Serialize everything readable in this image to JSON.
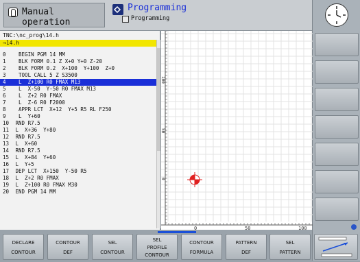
{
  "header": {
    "manual_label": "Manual operation",
    "programming_label": "Programming",
    "programming_sub": "Programming"
  },
  "program": {
    "path": "TNC:\\nc_prog\\14.h",
    "file": "→14.h",
    "selected_line": 4,
    "lines": [
      {
        "n": "0",
        "code": "  BEGIN PGM 14 MM"
      },
      {
        "n": "1",
        "code": "  BLK FORM 0.1 Z X+0 Y+0 Z-20"
      },
      {
        "n": "2",
        "code": "  BLK FORM 0.2  X+100  Y+100  Z+0"
      },
      {
        "n": "3",
        "code": "  TOOL CALL 5 Z S3500"
      },
      {
        "n": "4",
        "code": "  L  Z+100 R0 FMAX M13"
      },
      {
        "n": "5",
        "code": "  L  X-50  Y-50 R0 FMAX M13"
      },
      {
        "n": "6",
        "code": "  L  Z+2 R0 FMAX"
      },
      {
        "n": "7",
        "code": "  L  Z-6 R0 F2000"
      },
      {
        "n": "8",
        "code": "  APPR LCT  X+12  Y+5 R5 RL F250"
      },
      {
        "n": "9",
        "code": "  L  Y+60"
      },
      {
        "n": "10",
        "code": " RND R7.5"
      },
      {
        "n": "11",
        "code": " L  X+36  Y+80"
      },
      {
        "n": "12",
        "code": " RND R7.5"
      },
      {
        "n": "13",
        "code": " L  X+60"
      },
      {
        "n": "14",
        "code": " RND R7.5"
      },
      {
        "n": "15",
        "code": " L  X+84  Y+60"
      },
      {
        "n": "16",
        "code": " L  Y+5"
      },
      {
        "n": "17",
        "code": " DEP LCT  X+150  Y-50 R5"
      },
      {
        "n": "18",
        "code": " L  Z+2 R0 FMAX"
      },
      {
        "n": "19",
        "code": " L  Z+100 R0 FMAX M30"
      },
      {
        "n": "20",
        "code": " END PGM 14 MM"
      }
    ]
  },
  "graphic": {
    "x_ticks": [
      "0",
      "50",
      "100"
    ],
    "y_ticks": [
      "100",
      "50",
      "0"
    ]
  },
  "softkeys": [
    {
      "l1": "DECLARE",
      "l2": "CONTOUR"
    },
    {
      "l1": "CONTOUR",
      "l2": "DEF"
    },
    {
      "l1": "SEL",
      "l2": "CONTOUR"
    },
    {
      "l1": "SEL",
      "l2": "PROFILE",
      "l3": "CONTOUR"
    },
    {
      "l1": "CONTOUR",
      "l2": "FORMULA"
    },
    {
      "l1": "PATTERN",
      "l2": "DEF"
    },
    {
      "l1": "SEL",
      "l2": "PATTERN"
    }
  ],
  "colors": {
    "selection": "#1a2fd8",
    "file_highlight": "#f2e600",
    "datum": "#e02020"
  }
}
